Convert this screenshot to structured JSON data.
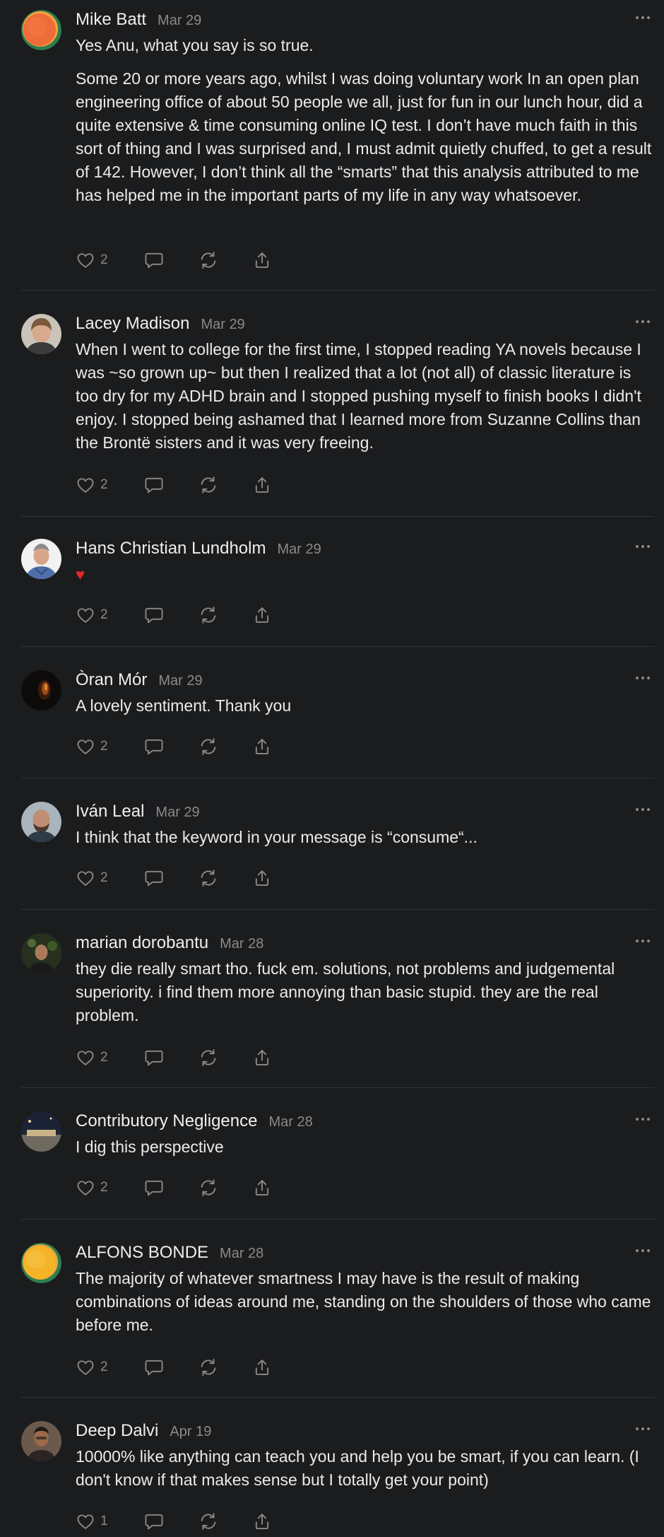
{
  "comments": [
    {
      "author": "Mike Batt",
      "date": "Mar 29",
      "paragraphs": [
        "Yes Anu, what you say is so true.",
        "Some 20 or more years ago, whilst I was doing voluntary work In an open plan engineering office of about 50 people we all, just for fun in our lunch hour, did a quite extensive & time consuming online IQ test. I don’t have much faith in this sort of thing and I was surprised and, I must admit quietly chuffed, to get a result of 142. However, I don’t think all the “smarts” that this analysis attributed to me has helped me in the important parts of my life in any way whatsoever."
      ],
      "likes": "2",
      "avatar_icon": "orange-circle-avatar"
    },
    {
      "author": "Lacey Madison",
      "date": "Mar 29",
      "paragraphs": [
        "When I went to college for the first time, I stopped reading YA novels because I was ~so grown up~ but then I realized that a lot (not all) of classic literature is too dry for my ADHD brain and I stopped pushing myself to finish books I didn't enjoy. I stopped being ashamed that I learned more from Suzanne Collins than the Brontë sisters and it was very freeing."
      ],
      "likes": "2",
      "avatar_icon": "photo-avatar"
    },
    {
      "author": "Hans Christian Lundholm",
      "date": "Mar 29",
      "paragraphs": [
        "♥"
      ],
      "likes": "2",
      "avatar_icon": "photo-avatar"
    },
    {
      "author": "Òran Mór",
      "date": "Mar 29",
      "paragraphs": [
        "A lovely sentiment. Thank you"
      ],
      "likes": "2",
      "avatar_icon": "photo-avatar"
    },
    {
      "author": "Iván Leal",
      "date": "Mar 29",
      "paragraphs": [
        "I think that the keyword in your message is “consume“..."
      ],
      "likes": "2",
      "avatar_icon": "photo-avatar"
    },
    {
      "author": "marian dorobantu",
      "date": "Mar 28",
      "paragraphs": [
        "they die really smart tho. fuck em. solutions, not problems and judgemental superiority. i find them more annoying than basic stupid. they are the real problem."
      ],
      "likes": "2",
      "avatar_icon": "photo-avatar"
    },
    {
      "author": "Contributory Negligence",
      "date": "Mar 28",
      "paragraphs": [
        "I dig this perspective"
      ],
      "likes": "2",
      "avatar_icon": "photo-avatar"
    },
    {
      "author": "ALFONS BONDE",
      "date": "Mar 28",
      "paragraphs": [
        "The majority of whatever smartness I may have is the result of making combinations of ideas around me, standing on the shoulders of those who came before me."
      ],
      "likes": "2",
      "avatar_icon": "yellow-circle-avatar"
    },
    {
      "author": "Deep Dalvi",
      "date": "Apr 19",
      "paragraphs": [
        "10000% like anything can teach you and help you be smart, if you can learn. (I don't know if that makes sense but I totally get your point)"
      ],
      "likes": "1",
      "avatar_icon": "photo-avatar"
    }
  ],
  "colors": {
    "background": "#1b1c1e",
    "text": "#ecebe8",
    "muted": "#8a8a88",
    "divider": "#323335",
    "heart_emoji": "#e22828"
  }
}
